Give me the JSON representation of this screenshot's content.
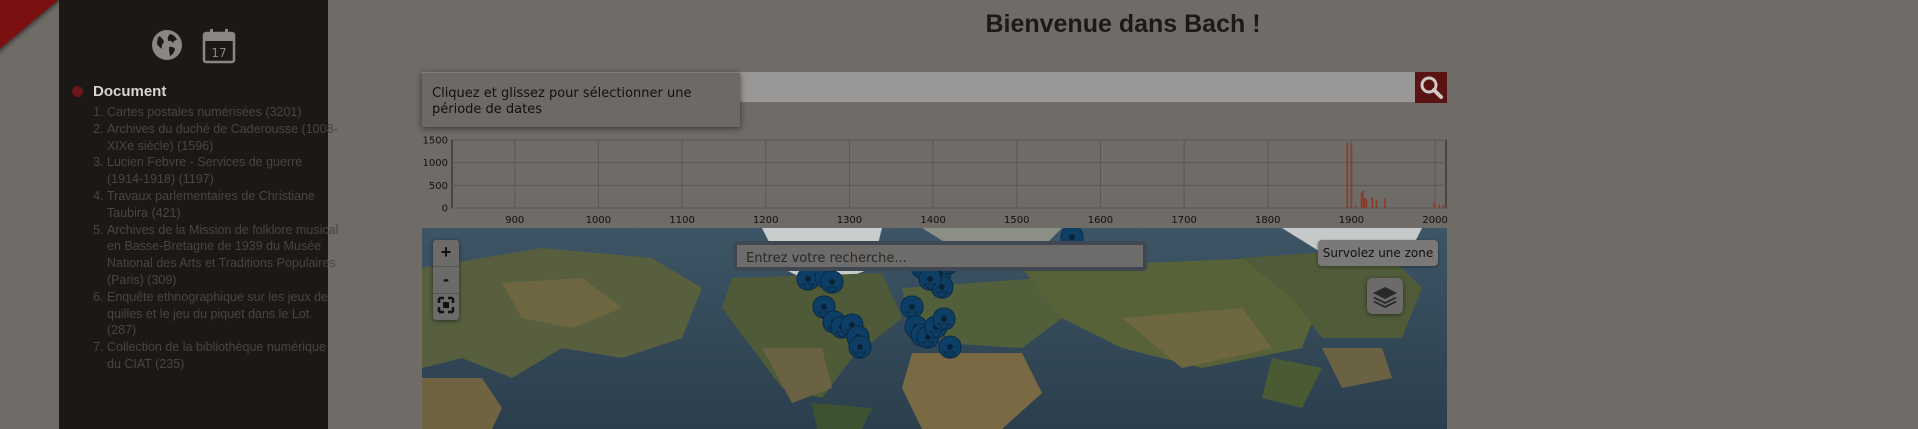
{
  "page": {
    "title": "Bienvenue dans Bach !"
  },
  "sidebar": {
    "icons": [
      "globe-icon",
      "calendar-icon"
    ],
    "calendar_day": "17",
    "section_title": "Document",
    "items": [
      {
        "label": "Cartes postales numérisées (3201)"
      },
      {
        "label": "Archives du duché de Caderousse (1008-XIXe siècle) (1596)"
      },
      {
        "label": "Lucien Febvre - Services de guerre (1914-1918) (1197)"
      },
      {
        "label": "Travaux parlementaires de Christiane Taubira (421)"
      },
      {
        "label": "Archives de la Mission de folklore musical en Basse-Bretagne de 1939 du Musée National des Arts et Traditions Populaires (Paris) (309)"
      },
      {
        "label": "Enquête ethnographique sur les jeux de quilles et le jeu du piquet dans le Lot. (287)"
      },
      {
        "label": "Collection de la bibliothèque numérique du CIAT (235)"
      }
    ]
  },
  "search": {
    "button_icon": "search-icon"
  },
  "tooltip": {
    "text": "Cliquez et glissez pour sélectionner une période de dates"
  },
  "chart_data": {
    "type": "bar",
    "x_ticks": [
      900,
      1000,
      1100,
      1200,
      1300,
      1400,
      1500,
      1600,
      1700,
      1800,
      1900,
      2000
    ],
    "y_ticks": [
      0,
      500,
      1000,
      1500
    ],
    "xlim": [
      825,
      2013
    ],
    "ylim": [
      0,
      1500
    ],
    "x": [
      1895,
      1900,
      1905,
      1912,
      1914,
      1916,
      1918,
      1925,
      1930,
      1940,
      1999,
      2005,
      2010
    ],
    "values": [
      1450,
      1380,
      60,
      340,
      380,
      220,
      200,
      240,
      180,
      210,
      120,
      80,
      70
    ],
    "bar_color": "#8a3a2a"
  },
  "map": {
    "search_placeholder": "Entrez votre recherche...",
    "hover_text": "Survolez une zone",
    "zoom_in": "+",
    "zoom_out": "-",
    "fullscreen_icon": "fullscreen-icon",
    "layers_icon": "layers-icon",
    "marker_color": "#0d3f66"
  }
}
